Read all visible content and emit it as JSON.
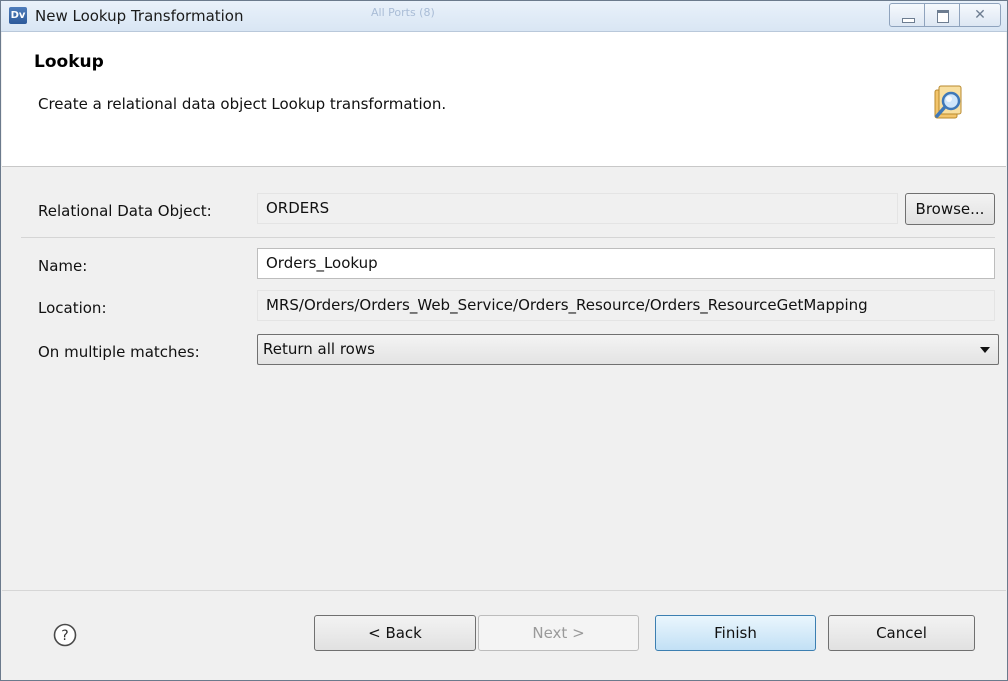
{
  "window": {
    "app_icon": "Dv",
    "title": "New Lookup Transformation",
    "background_ghost_text": "All Ports (8)",
    "controls": {
      "minimize": "minimize-icon",
      "maximize": "maximize-icon",
      "close": "close-icon"
    }
  },
  "header": {
    "title": "Lookup",
    "description": "Create a relational data object Lookup transformation.",
    "icon": "lookup-wizard-icon"
  },
  "form": {
    "relational_data_object": {
      "label": "Relational Data Object:",
      "value": "ORDERS",
      "browse_label": "Browse..."
    },
    "name": {
      "label": "Name:",
      "value": "Orders_Lookup"
    },
    "location": {
      "label": "Location:",
      "value": "MRS/Orders/Orders_Web_Service/Orders_Resource/Orders_ResourceGetMapping"
    },
    "multiple_matches": {
      "label": "On multiple matches:",
      "selected": "Return all rows"
    }
  },
  "footer": {
    "help": "?",
    "back_label": "< Back",
    "next_label": "Next >",
    "finish_label": "Finish",
    "cancel_label": "Cancel"
  },
  "colors": {
    "titlebar": "#dde8f5",
    "dialog_bg": "#f0f0f0",
    "header_bg": "#ffffff",
    "default_button_border": "#3c7fb1"
  }
}
